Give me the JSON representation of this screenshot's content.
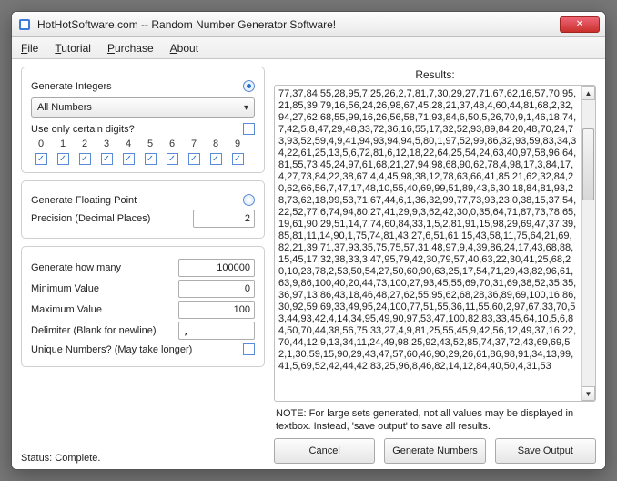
{
  "window": {
    "title": "HotHotSoftware.com -- Random Number Generator Software!"
  },
  "menu": {
    "file": "File",
    "tutorial": "Tutorial",
    "purchase": "Purchase",
    "about": "About"
  },
  "integers": {
    "title": "Generate Integers",
    "mode_label": "All Numbers",
    "use_digits_label": "Use only certain digits?",
    "digits": [
      "0",
      "1",
      "2",
      "3",
      "4",
      "5",
      "6",
      "7",
      "8",
      "9"
    ]
  },
  "floating": {
    "title": "Generate Floating Point",
    "precision_label": "Precision (Decimal Places)",
    "precision_value": "2"
  },
  "params": {
    "how_many_label": "Generate how many",
    "how_many_value": "100000",
    "min_label": "Minimum Value",
    "min_value": "0",
    "max_label": "Maximum Value",
    "max_value": "100",
    "delimiter_label": "Delimiter (Blank for newline)",
    "delimiter_value": ",",
    "unique_label": "Unique Numbers? (May take longer)"
  },
  "status": {
    "label": "Status: Complete."
  },
  "results": {
    "title": "Results:",
    "note": "NOTE: For large sets generated, not all values may be displayed in textbox. Instead, 'save output' to save all results.",
    "text": "77,37,84,55,28,95,7,25,26,2,7,81,7,30,29,27,71,67,62,16,57,70,95,21,85,39,79,16,56,24,26,98,67,45,28,21,37,48,4,60,44,81,68,2,32,94,27,62,68,55,99,16,26,56,58,71,93,84,6,50,5,26,70,9,1,46,18,74,7,42,5,8,47,29,48,33,72,36,16,55,17,32,52,93,89,84,20,48,70,24,73,93,52,59,4,9,41,94,93,94,94,5,80,1,97,52,99,86,32,93,59,83,34,34,22,61,25,13,5,6,72,81,6,12,18,22,64,25,54,24,63,40,97,58,96,64,81,55,73,45,24,97,61,68,21,27,94,98,68,90,62,78,4,98,17,3,84,17,4,27,73,84,22,38,67,4,4,45,98,38,12,78,63,66,41,85,21,62,32,84,20,62,66,56,7,47,17,48,10,55,40,69,99,51,89,43,6,30,18,84,81,93,28,73,62,18,99,53,71,67,44,6,1,36,32,99,77,73,93,23,0,38,15,37,54,22,52,77,6,74,94,80,27,41,29,9,3,62,42,30,0,35,64,71,87,73,78,65,19,61,90,29,51,14,7,74,60,84,33,1,5,2,81,91,15,98,29,69,47,37,39,85,81,11,14,90,1,75,74,81,43,27,6,51,61,15,43,58,11,75,64,21,69,82,21,39,71,37,93,35,75,75,57,31,48,97,9,4,39,86,24,17,43,68,88,15,45,17,32,38,33,3,47,95,79,42,30,79,57,40,63,22,30,41,25,68,20,10,23,78,2,53,50,54,27,50,60,90,63,25,17,54,71,29,43,82,96,61,63,9,86,100,40,20,44,73,100,27,93,45,55,69,70,31,69,38,52,35,35,36,97,13,86,43,18,46,48,27,62,55,95,62,68,28,36,89,69,100,16,86,30,92,59,69,33,49,95,24,100,77,51,55,36,11,55,60,2,97,67,33,70,53,44,93,42,4,14,34,95,49,90,97,53,47,100,82,83,33,45,64,10,5,6,84,50,70,44,38,56,75,33,27,4,9,81,25,55,45,9,42,56,12,49,37,16,22,70,44,12,9,13,34,11,24,49,98,25,92,43,52,85,74,37,72,43,69,69,52,1,30,59,15,90,29,43,47,57,60,46,90,29,26,61,86,98,91,34,13,99,41,5,69,52,42,44,42,83,25,96,8,46,82,14,12,84,40,50,4,31,53"
  },
  "buttons": {
    "cancel": "Cancel",
    "generate": "Generate Numbers",
    "save": "Save Output"
  }
}
